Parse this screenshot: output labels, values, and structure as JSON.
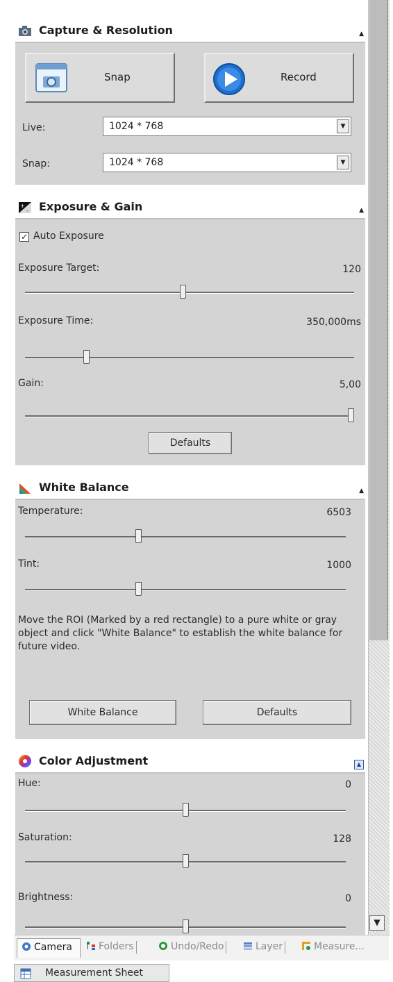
{
  "capture": {
    "title": "Capture & Resolution",
    "snap_label": "Snap",
    "record_label": "Record",
    "live_label": "Live:",
    "live_value": "1024 * 768",
    "snap_res_label": "Snap:",
    "snap_res_value": "1024 * 768"
  },
  "exposure": {
    "title": "Exposure & Gain",
    "auto_exposure_label": "Auto Exposure",
    "auto_exposure_checked": true,
    "target_label": "Exposure Target:",
    "target_value": "120",
    "target_level": 0.48,
    "time_label": "Exposure Time:",
    "time_value": "350,000ms",
    "time_level": 0.18,
    "gain_label": "Gain:",
    "gain_value": "5,00",
    "gain_level": 1.0,
    "defaults_label": "Defaults"
  },
  "white_balance": {
    "title": "White Balance",
    "temperature_label": "Temperature:",
    "temperature_value": "6503",
    "temperature_level": 0.35,
    "tint_label": "Tint:",
    "tint_value": "1000",
    "tint_level": 0.35,
    "description": "Move the ROI (Marked by a red rectangle) to a pure white or gray object and click \"White Balance\" to establish the white balance for future video.",
    "white_balance_button": "White Balance",
    "defaults_label": "Defaults"
  },
  "color": {
    "title": "Color Adjustment",
    "hue_label": "Hue:",
    "hue_value": "0",
    "hue_level": 0.5,
    "saturation_label": "Saturation:",
    "saturation_value": "128",
    "saturation_level": 0.5,
    "brightness_label": "Brightness:",
    "brightness_value": "0",
    "brightness_level": 0.5
  },
  "tabs": [
    "Camera",
    "Folders",
    "Undo/Redo",
    "Layer",
    "Measure..."
  ],
  "bottom_tab": "Measurement Sheet"
}
